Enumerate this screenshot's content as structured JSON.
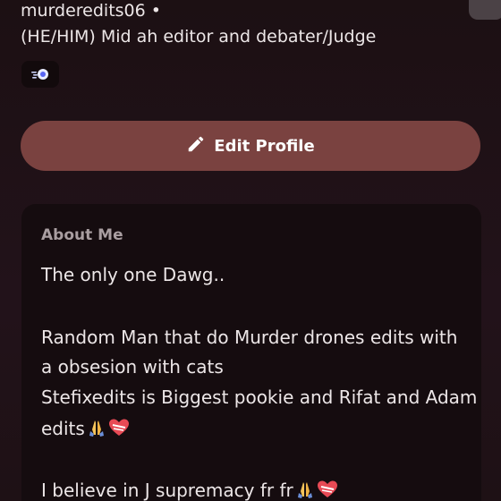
{
  "profile": {
    "username": "murderedits06",
    "separator": "•",
    "pronouns_bio": "(HE/HIM) Mid ah editor and debater/Judge",
    "badge_icon": "hypesquad-badge-icon"
  },
  "actions": {
    "edit_profile_label": "Edit Profile",
    "edit_icon": "pencil-icon"
  },
  "about": {
    "title": "About Me",
    "lines": [
      "The only one Dawg..",
      "Random Man that do Murder drones edits with",
      "a obsesion with cats",
      "Stefixedits is Biggest pookie and Rifat and Adam",
      "edits",
      "I believe in J supremacy fr fr"
    ]
  },
  "colors": {
    "background": "#1f1114",
    "button": "#7a4240",
    "card": "#150c0f",
    "muted_text": "#a99ea1",
    "text": "#ece6e7"
  }
}
